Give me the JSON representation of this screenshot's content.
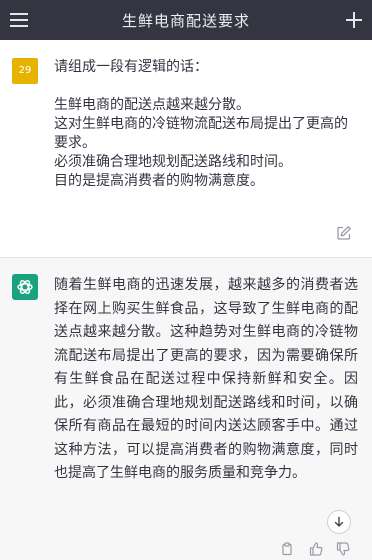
{
  "header": {
    "title": "生鲜电商配送要求",
    "menu_icon": "hamburger-menu-icon",
    "new_chat_icon": "plus-icon"
  },
  "user_message": {
    "avatar_text": "29",
    "avatar_color": "#e6b400",
    "lines": [
      "请组成一段有逻辑的话：",
      "",
      "生鲜电商的配送点越来越分散。",
      "这对生鲜电商的冷链物流配送布局提出了更高的要求。",
      "必须准确合理地规划配送路线和时间。",
      "目的是提高消费者的购物满意度。"
    ],
    "edit_icon": "edit-icon"
  },
  "assistant_message": {
    "avatar_icon": "openai-logo-icon",
    "avatar_color": "#19a27f",
    "text": "随着生鲜电商的迅速发展，越来越多的消费者选择在网上购买生鲜食品，这导致了生鲜电商的配送点越来越分散。这种趋势对生鲜电商的冷链物流配送布局提出了更高的要求，因为需要确保所有生鲜食品在配送过程中保持新鲜和安全。因此，必须准确合理地规划配送路线和时间，以确保所有商品在最短的时间内送达顾客手中。通过这种方法，可以提高消费者的购物满意度，同时也提高了生鲜电商的服务质量和竞争力。",
    "actions": [
      "copy-icon",
      "thumbs-up-icon",
      "thumbs-down-icon"
    ]
  },
  "scroll_button_icon": "arrow-down-icon"
}
